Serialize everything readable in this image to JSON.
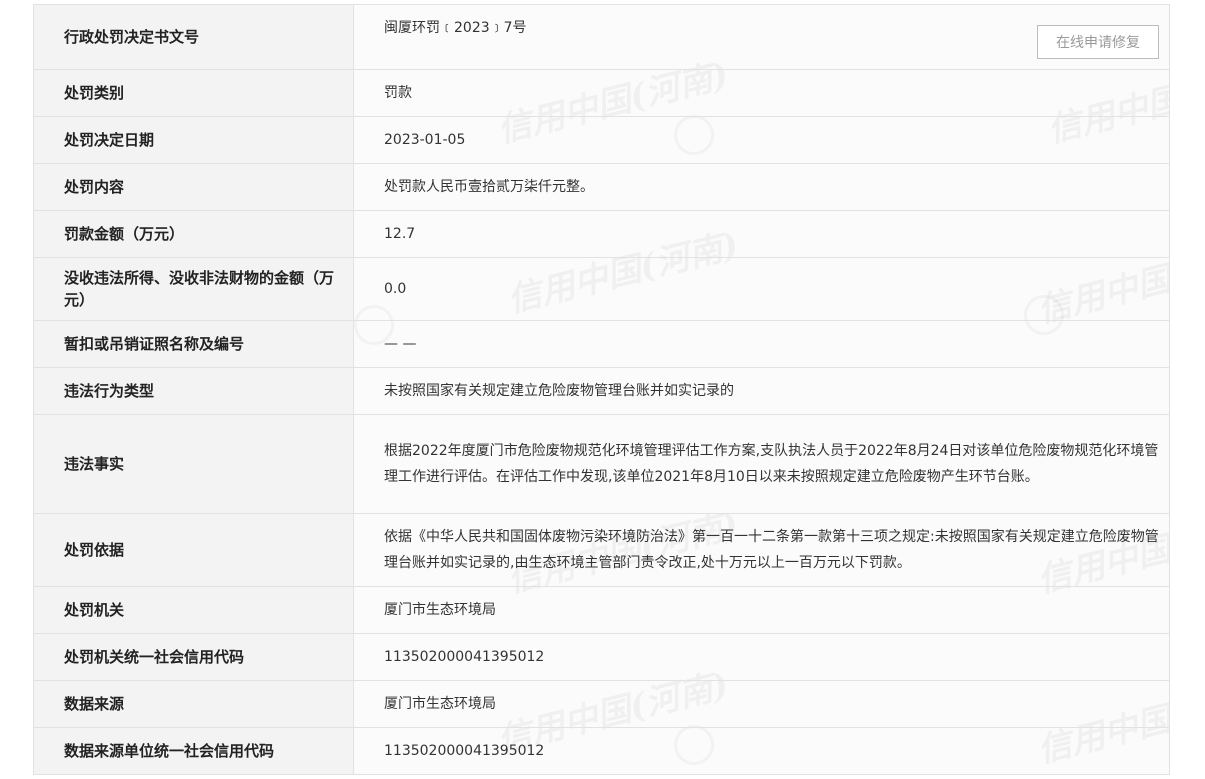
{
  "actions": {
    "repair_button": "在线申请修复"
  },
  "rows": [
    {
      "label": "行政处罚决定书文号",
      "value": "闽厦环罚﹝2023﹞7号"
    },
    {
      "label": "处罚类别",
      "value": "罚款"
    },
    {
      "label": "处罚决定日期",
      "value": "2023-01-05"
    },
    {
      "label": "处罚内容",
      "value": "处罚款人民币壹拾贰万柒仟元整。"
    },
    {
      "label": "罚款金额（万元）",
      "value": "12.7"
    },
    {
      "label": "没收违法所得、没收非法财物的金额（万元）",
      "value": "0.0"
    },
    {
      "label": "暂扣或吊销证照名称及编号",
      "value": "— —"
    },
    {
      "label": "违法行为类型",
      "value": "未按照国家有关规定建立危险废物管理台账并如实记录的"
    },
    {
      "label": "违法事实",
      "value": "根据2022年度厦门市危险废物规范化环境管理评估工作方案,支队执法人员于2022年8月24日对该单位危险废物规范化环境管理工作进行评估。在评估工作中发现,该单位2021年8月10日以来未按照规定建立危险废物产生环节台账。"
    },
    {
      "label": "处罚依据",
      "value": "依据《中华人民共和国固体废物污染环境防治法》第一百一十二条第一款第十三项之规定:未按照国家有关规定建立危险废物管理台账并如实记录的,由生态环境主管部门责令改正,处十万元以上一百万元以下罚款。"
    },
    {
      "label": "处罚机关",
      "value": "厦门市生态环境局"
    },
    {
      "label": "处罚机关统一社会信用代码",
      "value": "113502000041395012"
    },
    {
      "label": "数据来源",
      "value": "厦门市生态环境局"
    },
    {
      "label": "数据来源单位统一社会信用代码",
      "value": "113502000041395012"
    }
  ],
  "watermark": {
    "text": "信用中国(河南)"
  }
}
